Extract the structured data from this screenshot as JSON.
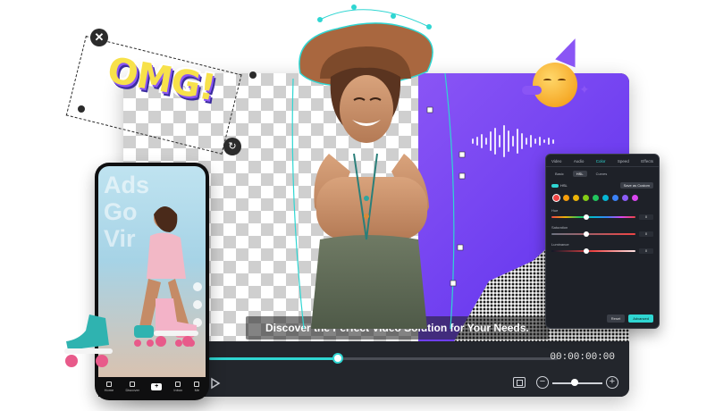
{
  "caption": "Discover the Perfect Video Solution for Your Needs.",
  "timecode": "00:00:00:00",
  "playback": {
    "progress": 0.37,
    "zoom": 0.45
  },
  "sticker": {
    "text": "OMG!",
    "close_glyph": "✕",
    "rotate_glyph": "↻"
  },
  "phone": {
    "bg_words": [
      "Ads",
      "Go",
      "Vir"
    ],
    "nav": [
      {
        "label": "Home"
      },
      {
        "label": "Discover"
      },
      {
        "label": "+"
      },
      {
        "label": "Inbox"
      },
      {
        "label": "Me"
      }
    ]
  },
  "panel": {
    "tabs": [
      "Video",
      "Audio",
      "Color",
      "Speed",
      "Effects"
    ],
    "active_tab": "Color",
    "sub_tabs": [
      "Basic",
      "HSL",
      "Curves"
    ],
    "active_sub_tab": "HSL",
    "hsl_label": "HSL",
    "save_label": "Save as Custom",
    "swatch_colors": [
      "#ef4444",
      "#f59e0b",
      "#eab308",
      "#84cc16",
      "#22c55e",
      "#06b6d4",
      "#3b82f6",
      "#8b5cf6",
      "#d946ef"
    ],
    "sliders": [
      {
        "label": "Hue",
        "value": "0",
        "position": 0.42
      },
      {
        "label": "Saturation",
        "value": "0",
        "position": 0.42
      },
      {
        "label": "Luminance",
        "value": "0",
        "position": 0.42
      }
    ],
    "reset_label": "Reset",
    "advanced_label": "Advanced"
  },
  "colors": {
    "accent": "#2fd6d2",
    "purple": "#8a55f5"
  }
}
